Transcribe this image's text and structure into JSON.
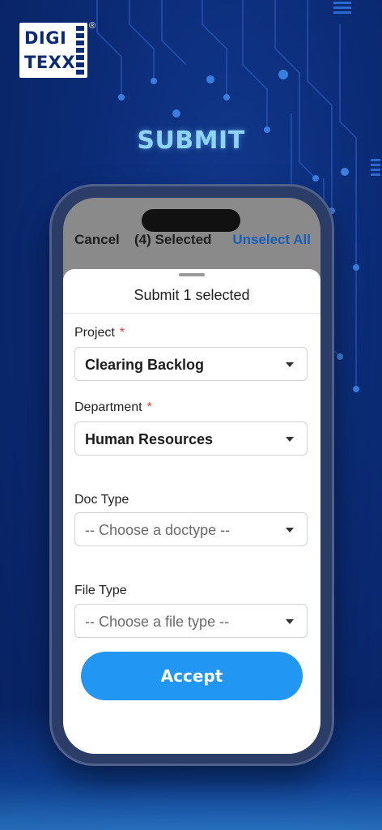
{
  "brand": {
    "line1": "DIGI",
    "line2": "TEXX",
    "reg": "®",
    "headline": "SUBMIT",
    "bg_color": "#0a2a73",
    "accent": "#8fd3ff"
  },
  "topbar": {
    "cancel": "Cancel",
    "selected": "(4) Selected",
    "unselect_all": "Unselect All"
  },
  "sheet": {
    "title": "Submit 1 selected",
    "fields": [
      {
        "label": "Project",
        "required": "*",
        "value": "Clearing Backlog"
      },
      {
        "label": "Department",
        "required": "*",
        "value": "Human Resources"
      },
      {
        "label": "Doc Type",
        "placeholder": "-- Choose a doctype --"
      },
      {
        "label": "File Type",
        "placeholder": "-- Choose a file type --"
      }
    ],
    "accept": "Accept",
    "accept_color": "#2196f3"
  }
}
